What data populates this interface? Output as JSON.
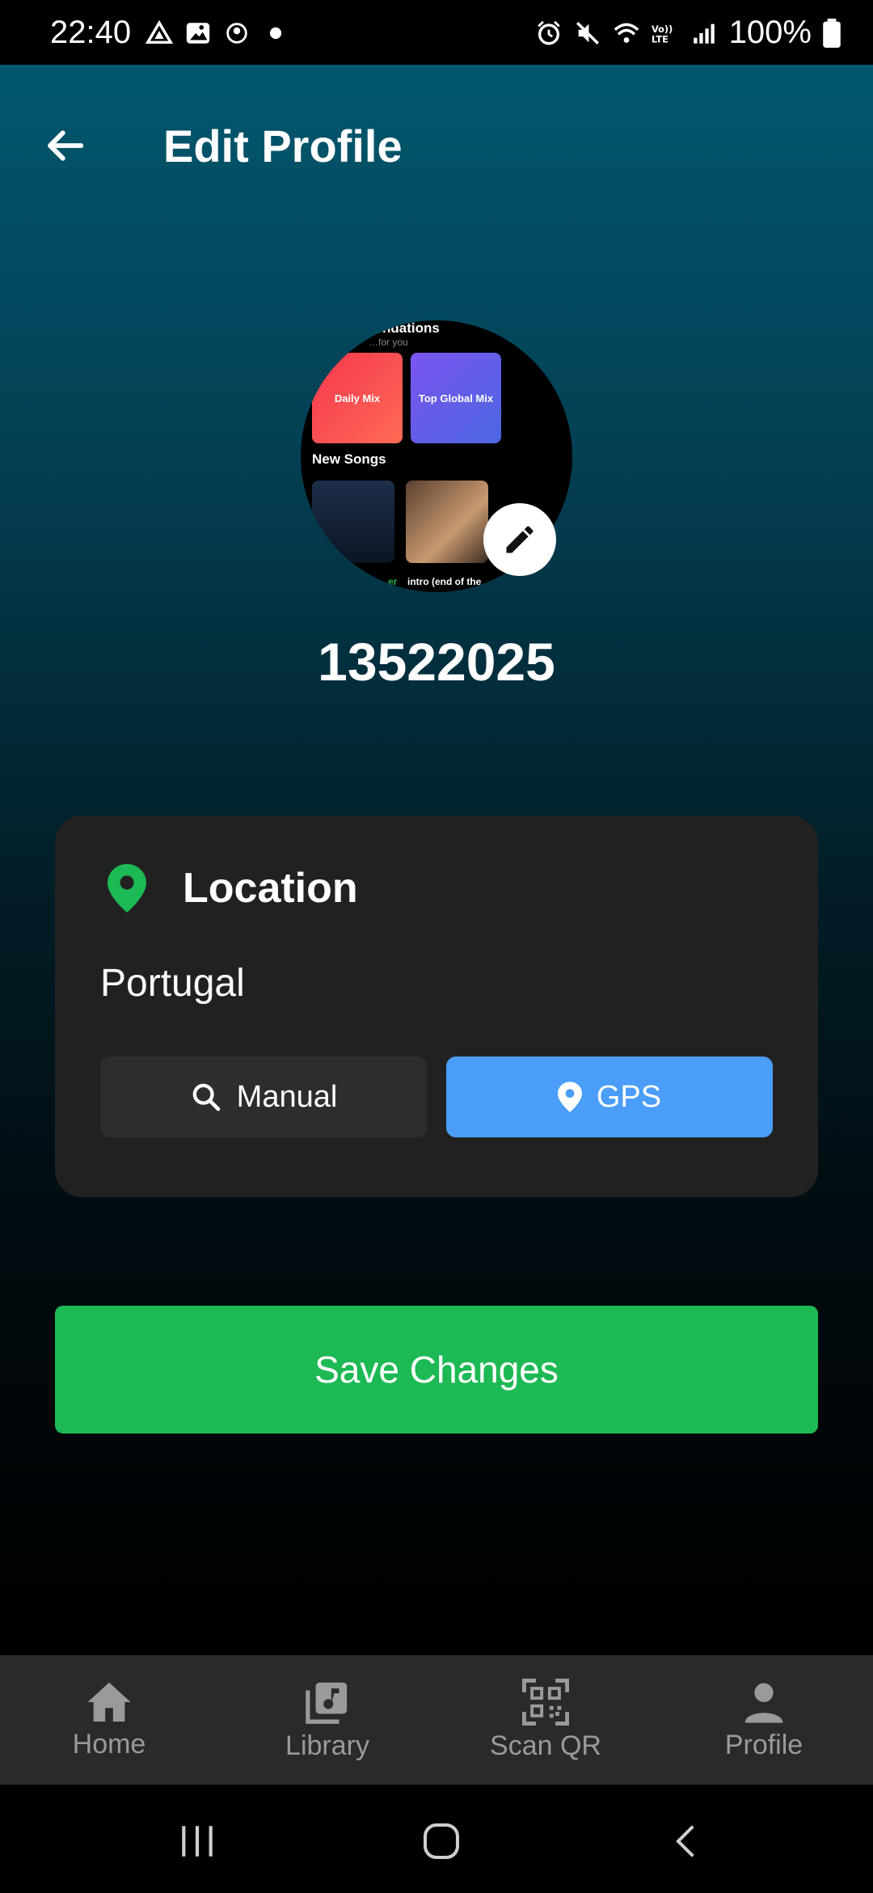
{
  "status_bar": {
    "time": "22:40",
    "battery": "100%",
    "left_icons": [
      "drive-icon",
      "gallery-icon",
      "app-icon",
      "dot-icon"
    ],
    "right_icons": [
      "alarm-icon",
      "mute-icon",
      "wifi-icon",
      "volte-icon",
      "signal-icon",
      "battery-icon"
    ]
  },
  "header": {
    "title": "Edit Profile",
    "back_icon": "arrow-left-icon"
  },
  "avatar": {
    "heading_fragment": "…ndations",
    "sub_fragment": "…for you",
    "card_1": "Daily Mix",
    "card_2": "Top Global Mix",
    "section": "New Songs",
    "caption_1": "…er",
    "caption_2": "intro (end of the",
    "edit_icon": "pencil-icon",
    "colors": {
      "card_1": "#f5374f",
      "card_2": "#6b5cf0"
    }
  },
  "profile": {
    "username": "13522025"
  },
  "location": {
    "title": "Location",
    "value": "Portugal",
    "manual_label": "Manual",
    "gps_label": "GPS",
    "icon": "map-pin-icon",
    "colors": {
      "pin": "#1db954",
      "gps": "#4a9df8"
    }
  },
  "actions": {
    "save_label": "Save Changes",
    "save_color": "#1db954"
  },
  "bottom_nav": {
    "items": [
      {
        "label": "Home",
        "icon": "home-icon"
      },
      {
        "label": "Library",
        "icon": "library-icon"
      },
      {
        "label": "Scan QR",
        "icon": "qr-code-icon"
      },
      {
        "label": "Profile",
        "icon": "person-icon"
      }
    ]
  },
  "system_nav": {
    "buttons": [
      "recents-icon",
      "home-circle-icon",
      "back-chevron-icon"
    ]
  }
}
